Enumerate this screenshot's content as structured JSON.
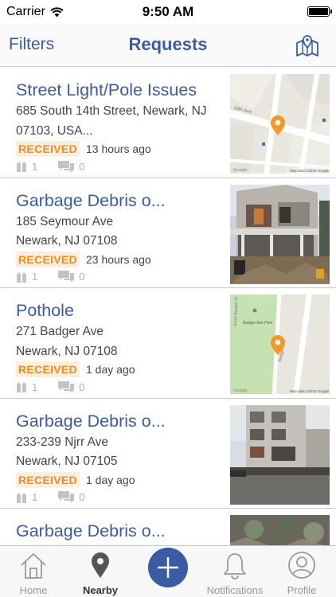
{
  "status_bar": {
    "carrier": "Carrier",
    "time": "9:50 AM",
    "battery_level": 1.0
  },
  "nav": {
    "left_label": "Filters",
    "title": "Requests",
    "right_icon": "map-pin-icon"
  },
  "requests": [
    {
      "title": "Street Light/Pole Issues",
      "address_line1": "685 South 14th Street, Newark, NJ",
      "address_line2": "07103, USA...",
      "status": "RECEIVED",
      "time": "13 hours ago",
      "follows": "1",
      "comments": "0",
      "thumbnail": "map"
    },
    {
      "title": "Garbage Debris o...",
      "address_line1": "185 Seymour Ave",
      "address_line2": "Newark, NJ 07108",
      "status": "RECEIVED",
      "time": "23 hours ago",
      "follows": "1",
      "comments": "0",
      "thumbnail": "photo-house"
    },
    {
      "title": "Pothole",
      "address_line1": "271 Badger Ave",
      "address_line2": "Newark, NJ 07108",
      "status": "RECEIVED",
      "time": "1 day ago",
      "follows": "1",
      "comments": "0",
      "thumbnail": "map"
    },
    {
      "title": "Garbage Debris o...",
      "address_line1": "233-239 Njrr Ave",
      "address_line2": "Newark, NJ 07105",
      "status": "RECEIVED",
      "time": "1 day ago",
      "follows": "1",
      "comments": "0",
      "thumbnail": "photo-building"
    },
    {
      "title": "Garbage Debris o...",
      "address_line1": "",
      "address_line2": "",
      "status": "",
      "time": "",
      "follows": "",
      "comments": "",
      "thumbnail": "photo-trees"
    }
  ],
  "map_text": {
    "street_19th": "19th Ave",
    "park": "Badger Ave Park",
    "street_badger": "Badger Ave",
    "street_bergen": "South Bergen St",
    "attribution": "Map data ©2015 Google",
    "google": "Google"
  },
  "tabs": [
    {
      "label": "Home",
      "icon": "home-icon",
      "active": false
    },
    {
      "label": "Nearby",
      "icon": "location-pin-icon",
      "active": true
    },
    {
      "label": "",
      "icon": "plus-icon",
      "active": false
    },
    {
      "label": "Notifications",
      "icon": "bell-icon",
      "active": false
    },
    {
      "label": "Profile",
      "icon": "profile-icon",
      "active": false
    }
  ],
  "colors": {
    "accent": "#3b5ba5",
    "status": "#ef8d1e",
    "status_bg": "#fbeede",
    "map_pin": "#f19a2a"
  }
}
